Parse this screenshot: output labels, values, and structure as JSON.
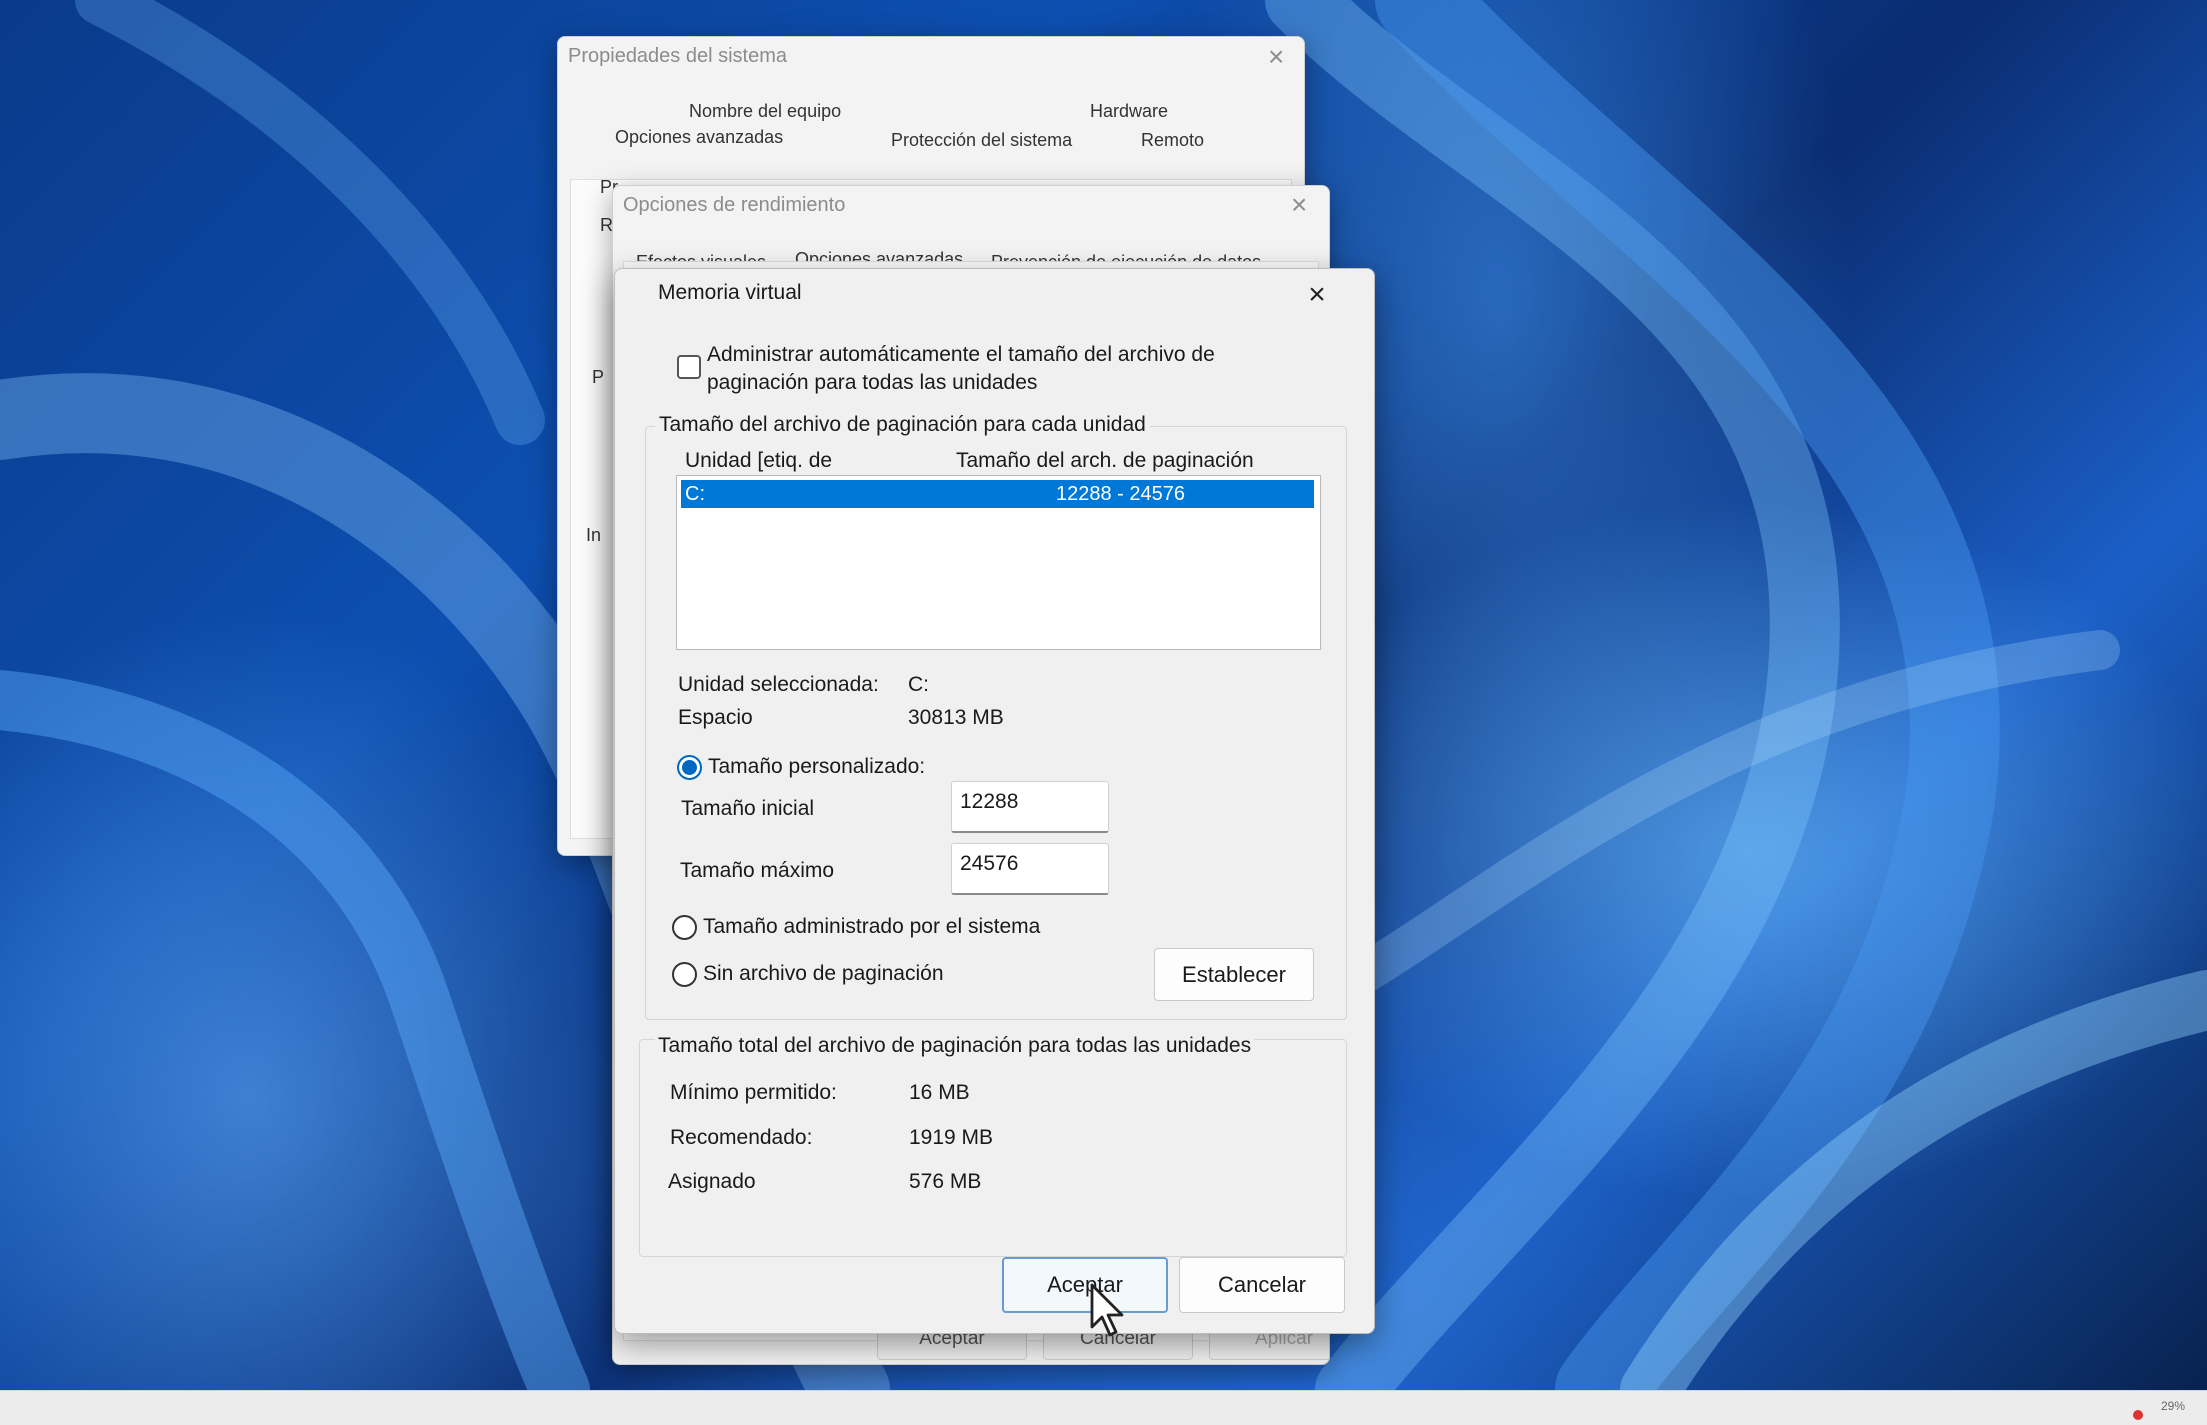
{
  "system_properties": {
    "title": "Propiedades del sistema",
    "tabs_row1": [
      "Nombre del equipo",
      "Hardware"
    ],
    "tabs_row2": [
      "Opciones avanzadas",
      "Protección del sistema",
      "Remoto"
    ],
    "clipped_text": [
      "Pr",
      "R",
      "P",
      "In"
    ]
  },
  "performance_options": {
    "title": "Opciones de rendimiento",
    "tabs": [
      "Efectos visuales",
      "Opciones avanzadas",
      "Prevención de ejecución de datos"
    ],
    "buttons": [
      "Aceptar",
      "Cancelar",
      "Aplicar"
    ]
  },
  "virtual_memory": {
    "title": "Memoria virtual",
    "auto_manage": {
      "line1": "Administrar automáticamente el tamaño del archivo de",
      "line2": "paginación para todas las unidades",
      "checked": false
    },
    "per_drive_group_label": "Tamaño del archivo de paginación para cada unidad",
    "list_headers": {
      "drive": "Unidad [etiq. de",
      "size": "Tamaño del arch. de paginación"
    },
    "drives": [
      {
        "drive": "C:",
        "size": "12288 - 24576",
        "selected": true
      }
    ],
    "selected_drive": {
      "label": "Unidad seleccionada:",
      "value": "C:"
    },
    "space": {
      "label": "Espacio",
      "value": "30813 MB"
    },
    "custom_size": {
      "label": "Tamaño personalizado:",
      "selected": true,
      "initial": {
        "label": "Tamaño inicial",
        "value": "12288"
      },
      "maximum": {
        "label": "Tamaño máximo",
        "value": "24576"
      }
    },
    "system_managed": {
      "label": "Tamaño administrado por el sistema",
      "selected": false
    },
    "no_paging": {
      "label": "Sin archivo de paginación",
      "selected": false
    },
    "set_button": "Establecer",
    "total_group_label": "Tamaño total del archivo de paginación para todas las unidades",
    "totals": [
      {
        "label": "Mínimo permitido:",
        "value": "16 MB"
      },
      {
        "label": "Recomendado:",
        "value": "1919 MB"
      },
      {
        "label": "Asignado",
        "value": "576 MB"
      }
    ],
    "ok_button": "Aceptar",
    "cancel_button": "Cancelar"
  },
  "taskbar": {
    "battery": "29%"
  },
  "colors": {
    "selection": "#0078d7",
    "accent": "#0067c0"
  }
}
